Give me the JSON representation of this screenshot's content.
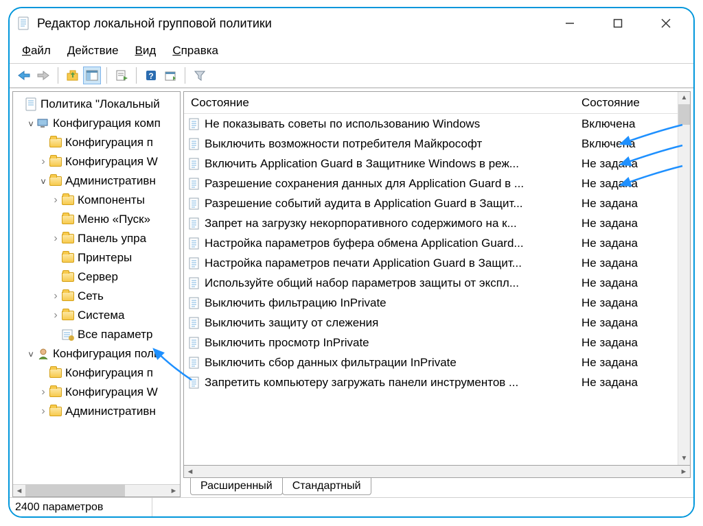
{
  "window": {
    "title": "Редактор локальной групповой политики"
  },
  "menu": {
    "file": "Файл",
    "action": "Действие",
    "view": "Вид",
    "help": "Справка"
  },
  "tree": {
    "root": "Политика \"Локальный",
    "comp_config": "Конфигурация комп",
    "comp_soft": "Конфигурация п",
    "comp_win": "Конфигурация W",
    "admin_templates": "Административн",
    "components": "Компоненты",
    "start_menu": "Меню «Пуск»",
    "control_panel": "Панель упра",
    "printers": "Принтеры",
    "server": "Сервер",
    "network": "Сеть",
    "system": "Система",
    "all_settings": "Все параметр",
    "user_config": "Конфигурация поль",
    "user_soft": "Конфигурация п",
    "user_win": "Конфигурация W",
    "user_admin": "Административн"
  },
  "columns": {
    "name": "Состояние",
    "state": "Состояние"
  },
  "policies": [
    {
      "name": "Не показывать советы по использованию Windows",
      "state": "Включена"
    },
    {
      "name": "Выключить возможности потребителя Майкрософт",
      "state": "Включена"
    },
    {
      "name": "Включить Application Guard в Защитнике Windows в реж...",
      "state": "Не задана"
    },
    {
      "name": "Разрешение сохранения данных для Application Guard в ...",
      "state": "Не задана"
    },
    {
      "name": "Разрешение событий аудита в Application Guard в Защит...",
      "state": "Не задана"
    },
    {
      "name": "Запрет на загрузку некорпоративного содержимого на к...",
      "state": "Не задана"
    },
    {
      "name": "Настройка параметров буфера обмена Application Guard...",
      "state": "Не задана"
    },
    {
      "name": "Настройка параметров печати Application Guard в Защит...",
      "state": "Не задана"
    },
    {
      "name": "Используйте общий набор параметров защиты от экспл...",
      "state": "Не задана"
    },
    {
      "name": "Выключить фильтрацию InPrivate",
      "state": "Не задана"
    },
    {
      "name": "Выключить защиту от слежения",
      "state": "Не задана"
    },
    {
      "name": "Выключить просмотр InPrivate",
      "state": "Не задана"
    },
    {
      "name": "Выключить сбор данных фильтрации InPrivate",
      "state": "Не задана"
    },
    {
      "name": "Запретить компьютеру загружать панели инструментов ...",
      "state": "Не задана"
    }
  ],
  "tabs": {
    "extended": "Расширенный",
    "standard": "Стандартный"
  },
  "status": "2400 параметров"
}
